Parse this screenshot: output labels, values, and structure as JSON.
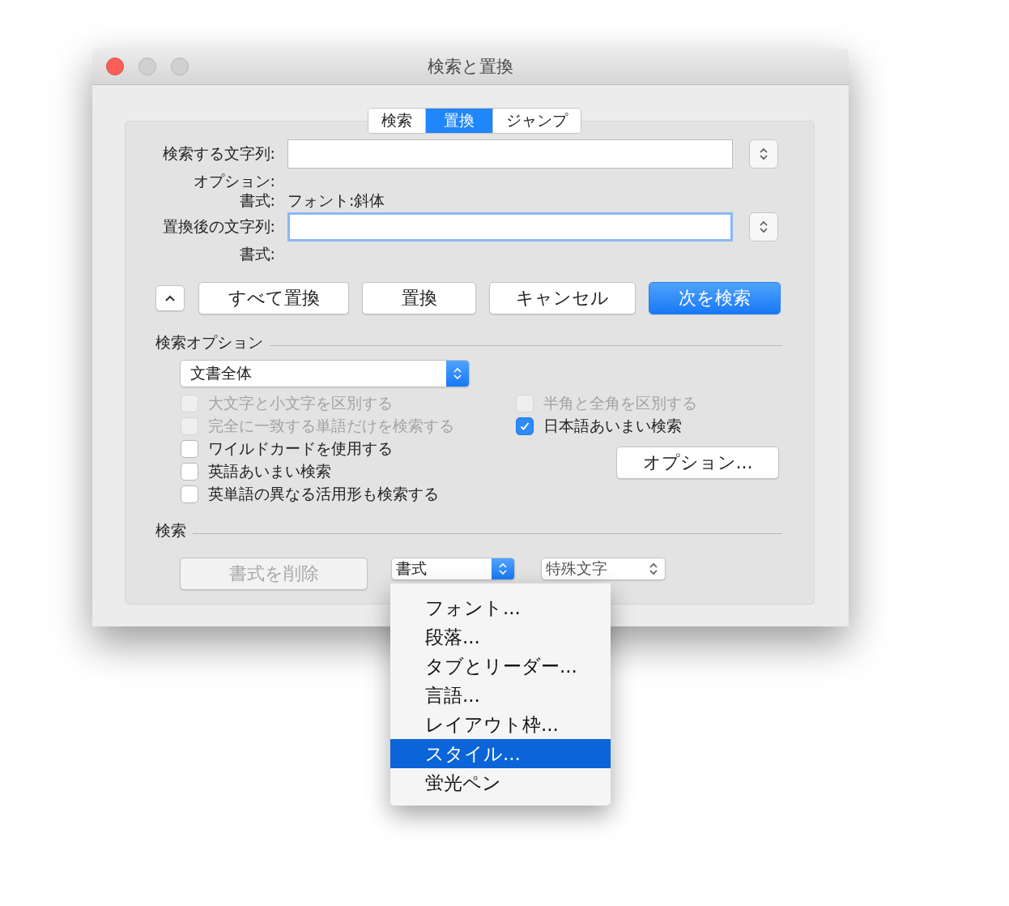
{
  "window": {
    "title": "検索と置換"
  },
  "tabs": [
    {
      "label": "検索",
      "selected": false
    },
    {
      "label": "置換",
      "selected": true
    },
    {
      "label": "ジャンプ",
      "selected": false
    }
  ],
  "find": {
    "label": "検索する文字列:",
    "focused": false
  },
  "options_label": "オプション:",
  "find_format": {
    "label": "書式:",
    "value": "フォント:斜体"
  },
  "replace": {
    "label": "置換後の文字列:",
    "focused": true
  },
  "replace_format": {
    "label": "書式:"
  },
  "buttons": [
    {
      "label": "すべて置換",
      "default": false
    },
    {
      "label": "置換",
      "default": false
    },
    {
      "label": "キャンセル",
      "default": false
    },
    {
      "label": "次を検索",
      "default": true
    }
  ],
  "search_options": {
    "title": "検索オプション",
    "scope": "文書全体",
    "left": [
      {
        "label": "大文字と小文字を区別する",
        "checked": false,
        "disabled": true
      },
      {
        "label": "完全に一致する単語だけを検索する",
        "checked": false,
        "disabled": true
      },
      {
        "label": "ワイルドカードを使用する",
        "checked": false,
        "disabled": false
      },
      {
        "label": "英語あいまい検索",
        "checked": false,
        "disabled": false
      },
      {
        "label": "英単語の異なる活用形も検索する",
        "checked": false,
        "disabled": false
      }
    ],
    "right": [
      {
        "label": "半角と全角を区別する",
        "checked": false,
        "disabled": true
      },
      {
        "label": "日本語あいまい検索",
        "checked": true,
        "disabled": false
      }
    ],
    "options_button": "オプション..."
  },
  "search": {
    "title": "検索",
    "clear_button": {
      "label": "書式を削除",
      "disabled": true
    },
    "format_popup": "書式",
    "special_popup": "特殊文字"
  },
  "menu": [
    {
      "label": "フォント...",
      "selected": false
    },
    {
      "label": "段落...",
      "selected": false
    },
    {
      "label": "タブとリーダー...",
      "selected": false
    },
    {
      "label": "言語...",
      "selected": false
    },
    {
      "label": "レイアウト枠...",
      "selected": false
    },
    {
      "label": "スタイル...",
      "selected": true
    },
    {
      "label": "蛍光ペン",
      "selected": false
    }
  ]
}
